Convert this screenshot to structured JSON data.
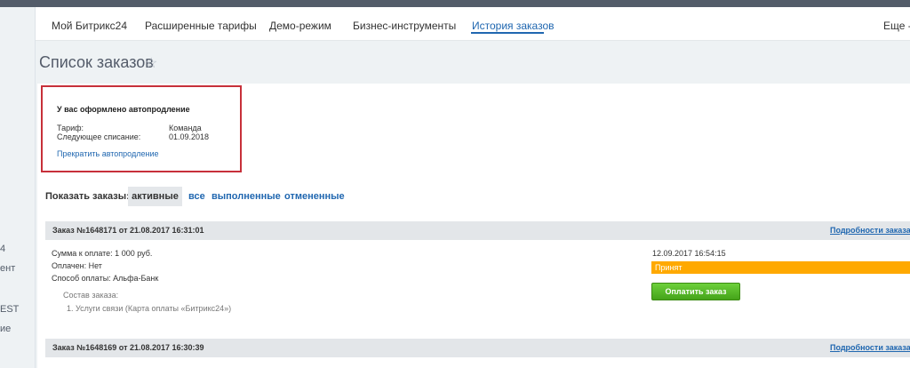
{
  "left_sidebar": {
    "fragments": [
      "4",
      "ент",
      "EST",
      "ие"
    ]
  },
  "tabs": [
    {
      "label": "Мой Битрикс24",
      "active": false
    },
    {
      "label": "Расширенные тарифы",
      "active": false
    },
    {
      "label": "Демо-режим",
      "active": false
    },
    {
      "label": "Бизнес-инструменты",
      "active": false
    },
    {
      "label": "История заказов",
      "active": true
    }
  ],
  "more_tab": "Еще -",
  "page": {
    "title": "Список заказов",
    "favorite_icon": "star-icon"
  },
  "autopay": {
    "heading": "У вас оформлено автопродление",
    "tariff_label": "Тариф:",
    "tariff_value": "Команда",
    "next_charge_label": "Следующее списание:",
    "next_charge_value": "01.09.2018",
    "cancel_link": "Прекратить автопродление"
  },
  "filter": {
    "label": "Показать заказы:",
    "active": "активные",
    "options": [
      "все",
      "выполненные",
      "отмененные"
    ]
  },
  "orders": [
    {
      "title": "Заказ №1648171 от 21.08.2017 16:31:01",
      "details_link": "Подробности заказа",
      "amount": "Сумма к оплате: 1 000 руб.",
      "paid": "Оплачен: Нет",
      "payment_method": "Способ оплаты: Альфа-Банк",
      "composition_label": "Состав заказа:",
      "items": [
        "1. Услуги связи (Карта оплаты «Битрикс24»)"
      ],
      "status_time": "12.09.2017 16:54:15",
      "status": "Принят",
      "pay_button": "Оплатить заказ"
    },
    {
      "title": "Заказ №1648169 от 21.08.2017 16:30:39",
      "details_link": "Подробности заказа"
    }
  ],
  "colors": {
    "accent": "#2067b0",
    "highlight_border": "#c7303a",
    "status": "#ffa900",
    "pay_button": "#55b82a"
  }
}
